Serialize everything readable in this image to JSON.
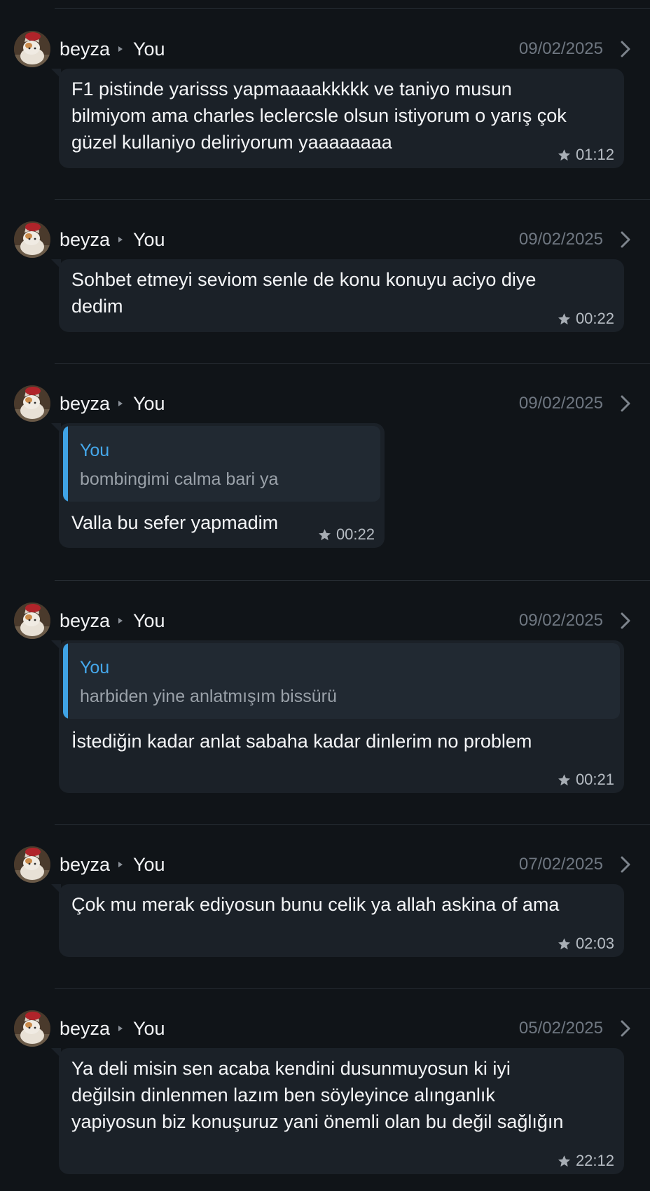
{
  "conversation": {
    "messages": [
      {
        "sender": "beyza",
        "recipient": "You",
        "date": "09/02/2025",
        "text": "F1 pistinde yarisss yapmaaaakkkkk ve taniyo musun\nbilmiyom ama charles leclercsle olsun istiyorum o yarış çok\ngüzel kullaniyo deliriyorum yaaaaaaaa",
        "time": "01:12",
        "starred": true
      },
      {
        "sender": "beyza",
        "recipient": "You",
        "date": "09/02/2025",
        "text": "Sohbet etmeyi seviom senle de konu konuyu aciyo diye\ndedim",
        "time": "00:22",
        "starred": true
      },
      {
        "sender": "beyza",
        "recipient": "You",
        "date": "09/02/2025",
        "reply_to": {
          "author": "You",
          "text": "bombingimi calma bari ya"
        },
        "text": "Valla bu sefer yapmadim",
        "time": "00:22",
        "starred": true
      },
      {
        "sender": "beyza",
        "recipient": "You",
        "date": "09/02/2025",
        "reply_to": {
          "author": "You",
          "text": "harbiden yine anlatmışım bissürü"
        },
        "text": "İstediğin kadar anlat sabaha kadar dinlerim no problem",
        "time": "00:21",
        "starred": true
      },
      {
        "sender": "beyza",
        "recipient": "You",
        "date": "07/02/2025",
        "text": "Çok mu merak ediyosun bunu celik ya allah askina of ama",
        "time": "02:03",
        "starred": true
      },
      {
        "sender": "beyza",
        "recipient": "You",
        "date": "05/02/2025",
        "text": "Ya deli misin sen acaba kendini dusunmuyosun ki iyi\ndeğilsin dinlenmen lazım ben söyleyince alınganlık\nyapiyosun biz konuşuruz yani önemli olan bu değil sağlığın",
        "time": "22:12",
        "starred": true
      }
    ]
  },
  "icons": {
    "separator": "play-triangle-icon",
    "open": "chevron-right-icon",
    "starred": "star-icon"
  },
  "colors": {
    "background": "#101418",
    "bubble": "#1b2128",
    "quote_accent": "#3fa3e6",
    "quote_author": "#45a8ec",
    "date_text": "#6f7781"
  }
}
